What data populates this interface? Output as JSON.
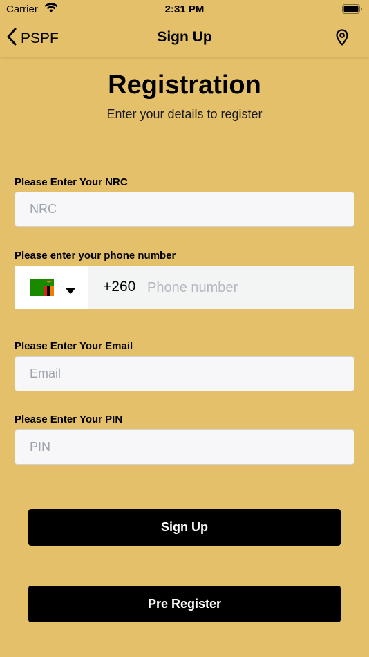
{
  "status_bar": {
    "carrier": "Carrier",
    "time": "2:31 PM",
    "wifi_icon": "wifi-icon",
    "battery_icon": "battery-icon"
  },
  "nav": {
    "back_label": "PSPF",
    "title": "Sign Up",
    "back_icon": "chevron-left-icon",
    "location_icon": "location-pin-icon"
  },
  "header": {
    "title": "Registration",
    "subtitle": "Enter your details to register"
  },
  "form": {
    "nrc": {
      "label": "Please Enter Your NRC",
      "placeholder": "NRC",
      "value": ""
    },
    "phone": {
      "label": "Please enter your phone number",
      "country_flag": "zambia-flag-icon",
      "dial_code": "+260",
      "placeholder": "Phone number",
      "value": ""
    },
    "email": {
      "label": "Please Enter Your Email",
      "placeholder": "Email",
      "value": ""
    },
    "pin": {
      "label": "Please Enter Your PIN",
      "placeholder": "PIN",
      "value": ""
    }
  },
  "buttons": {
    "sign_up": "Sign Up",
    "pre_register": "Pre Register"
  },
  "colors": {
    "background": "#E5C06A",
    "button": "#000000",
    "button_text": "#FFFFFF",
    "field_background": "#F7F7FA"
  }
}
